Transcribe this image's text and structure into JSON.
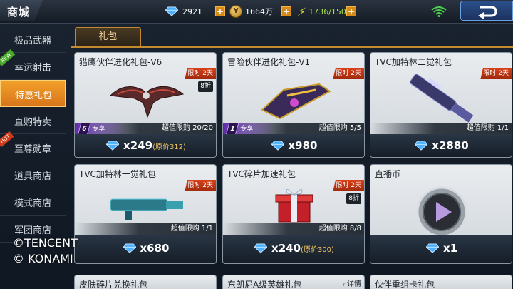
{
  "header": {
    "title": "商城",
    "diamonds": "2921",
    "coins": "1664万",
    "energy": "1736/150",
    "coin_glyph": "¥"
  },
  "sidebar": {
    "items": [
      {
        "label": "极品武器",
        "active": false,
        "tag": ""
      },
      {
        "label": "幸运射击",
        "active": false,
        "tag": "NEW"
      },
      {
        "label": "特惠礼包",
        "active": true,
        "tag": ""
      },
      {
        "label": "直购特卖",
        "active": false,
        "tag": ""
      },
      {
        "label": "至尊勋章",
        "active": false,
        "tag": "HOT"
      },
      {
        "label": "道具商店",
        "active": false,
        "tag": ""
      },
      {
        "label": "模式商店",
        "active": false,
        "tag": ""
      },
      {
        "label": "军团商店",
        "active": false,
        "tag": ""
      }
    ]
  },
  "tab": {
    "label": "礼包"
  },
  "cards": [
    {
      "title": "猎鹰伙伴进化礼包-V6",
      "limit": "限时 2天",
      "discount": "8折",
      "exclusive_level": "6",
      "exclusive_label": "专享",
      "stock": "超值限购 20/20",
      "price": "x249",
      "orig": "(原价312)"
    },
    {
      "title": "冒险伙伴进化礼包-V1",
      "limit": "限时 2天",
      "discount": "",
      "exclusive_level": "1",
      "exclusive_label": "专享",
      "stock": "超值限购 5/5",
      "price": "x980",
      "orig": ""
    },
    {
      "title": "TVC加特林二觉礼包",
      "limit": "限时 2天",
      "discount": "",
      "exclusive_level": "",
      "exclusive_label": "",
      "stock": "超值限购 1/1",
      "price": "x2880",
      "orig": ""
    },
    {
      "title": "TVC加特林一觉礼包",
      "limit": "限时 2天",
      "discount": "",
      "stock": "超值限购 1/1",
      "price": "x680",
      "orig": ""
    },
    {
      "title": "TVC碎片加速礼包",
      "limit": "限时 2天",
      "discount": "8折",
      "stock": "超值限购 8/8",
      "price": "x240",
      "orig": "(原价300)"
    },
    {
      "title": "直播币",
      "limit": "",
      "discount": "",
      "stock": "",
      "price": "x1",
      "orig": ""
    },
    {
      "title": "皮肤碎片兑换礼包",
      "detail": ""
    },
    {
      "title": "东朗尼A级英雄礼包",
      "detail": "详情"
    },
    {
      "title": "伙伴重组卡礼包",
      "detail": ""
    }
  ],
  "watermark": {
    "line1": "©TENCENT",
    "line2": "© KONAMI"
  },
  "colors": {
    "accent": "#f2a02a",
    "limit_red": "#c4361a",
    "diamond": "#4ab0ff"
  }
}
